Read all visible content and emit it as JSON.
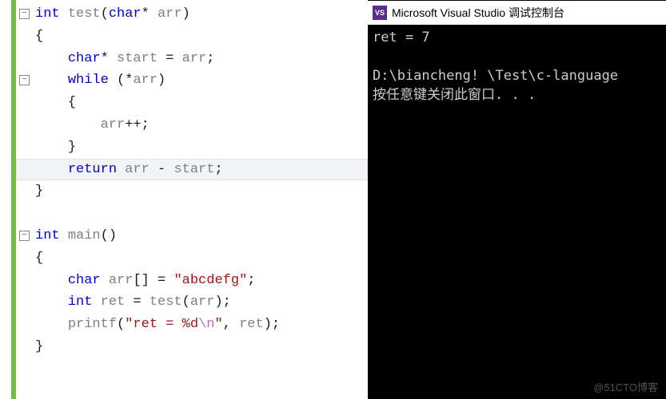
{
  "editor": {
    "lines": [
      {
        "fold": true,
        "indent": 0,
        "tokens": [
          [
            "kw",
            "int"
          ],
          [
            "paren",
            " "
          ],
          [
            "ident",
            "test"
          ],
          [
            "paren",
            "("
          ],
          [
            "kw",
            "char"
          ],
          [
            "op",
            "* "
          ],
          [
            "ident",
            "arr"
          ],
          [
            "paren",
            ")"
          ]
        ]
      },
      {
        "indent": 0,
        "tokens": [
          [
            "paren",
            "{"
          ]
        ]
      },
      {
        "indent": 1,
        "tokens": [
          [
            "kw",
            "char"
          ],
          [
            "op",
            "* "
          ],
          [
            "ident",
            "start"
          ],
          [
            "op",
            " = "
          ],
          [
            "ident",
            "arr"
          ],
          [
            "paren",
            ";"
          ]
        ]
      },
      {
        "fold": true,
        "indent": 1,
        "tokens": [
          [
            "kw",
            "while"
          ],
          [
            "paren",
            " ("
          ],
          [
            "op",
            "*"
          ],
          [
            "ident",
            "arr"
          ],
          [
            "paren",
            ")"
          ]
        ]
      },
      {
        "indent": 1,
        "tokens": [
          [
            "paren",
            "{"
          ]
        ]
      },
      {
        "indent": 2,
        "tokens": [
          [
            "ident",
            "arr"
          ],
          [
            "op",
            "++"
          ],
          [
            "paren",
            ";"
          ]
        ]
      },
      {
        "indent": 1,
        "tokens": [
          [
            "paren",
            "}"
          ]
        ]
      },
      {
        "highlight": true,
        "indent": 1,
        "tokens": [
          [
            "kw",
            "return"
          ],
          [
            "paren",
            " "
          ],
          [
            "ident",
            "arr"
          ],
          [
            "op",
            " - "
          ],
          [
            "ident",
            "start"
          ],
          [
            "paren",
            ";"
          ]
        ]
      },
      {
        "indent": 0,
        "tokens": [
          [
            "paren",
            "}"
          ]
        ]
      },
      {
        "blank": true
      },
      {
        "fold": true,
        "indent": 0,
        "tokens": [
          [
            "kw",
            "int"
          ],
          [
            "paren",
            " "
          ],
          [
            "ident",
            "main"
          ],
          [
            "paren",
            "()"
          ]
        ]
      },
      {
        "indent": 0,
        "tokens": [
          [
            "paren",
            "{"
          ]
        ]
      },
      {
        "indent": 1,
        "tokens": [
          [
            "kw",
            "char"
          ],
          [
            "paren",
            " "
          ],
          [
            "ident",
            "arr"
          ],
          [
            "paren",
            "[] = "
          ],
          [
            "str",
            "\"abcdefg\""
          ],
          [
            "paren",
            ";"
          ]
        ]
      },
      {
        "indent": 1,
        "tokens": [
          [
            "kw",
            "int"
          ],
          [
            "paren",
            " "
          ],
          [
            "ident",
            "ret"
          ],
          [
            "op",
            " = "
          ],
          [
            "ident",
            "test"
          ],
          [
            "paren",
            "("
          ],
          [
            "ident",
            "arr"
          ],
          [
            "paren",
            ");"
          ]
        ]
      },
      {
        "indent": 1,
        "tokens": [
          [
            "ident",
            "printf"
          ],
          [
            "paren",
            "("
          ],
          [
            "str",
            "\"ret = %d"
          ],
          [
            "esc",
            "\\n"
          ],
          [
            "str",
            "\""
          ],
          [
            "paren",
            ", "
          ],
          [
            "ident",
            "ret"
          ],
          [
            "paren",
            ");"
          ]
        ]
      },
      {
        "indent": 0,
        "tokens": [
          [
            "paren",
            "}"
          ]
        ]
      }
    ]
  },
  "console": {
    "icon_label": "VS",
    "title": "Microsoft Visual Studio 调试控制台",
    "output": "ret = 7\n\nD:\\biancheng! \\Test\\c-language\n按任意键关闭此窗口. . ."
  },
  "watermark": "@51CTO博客"
}
